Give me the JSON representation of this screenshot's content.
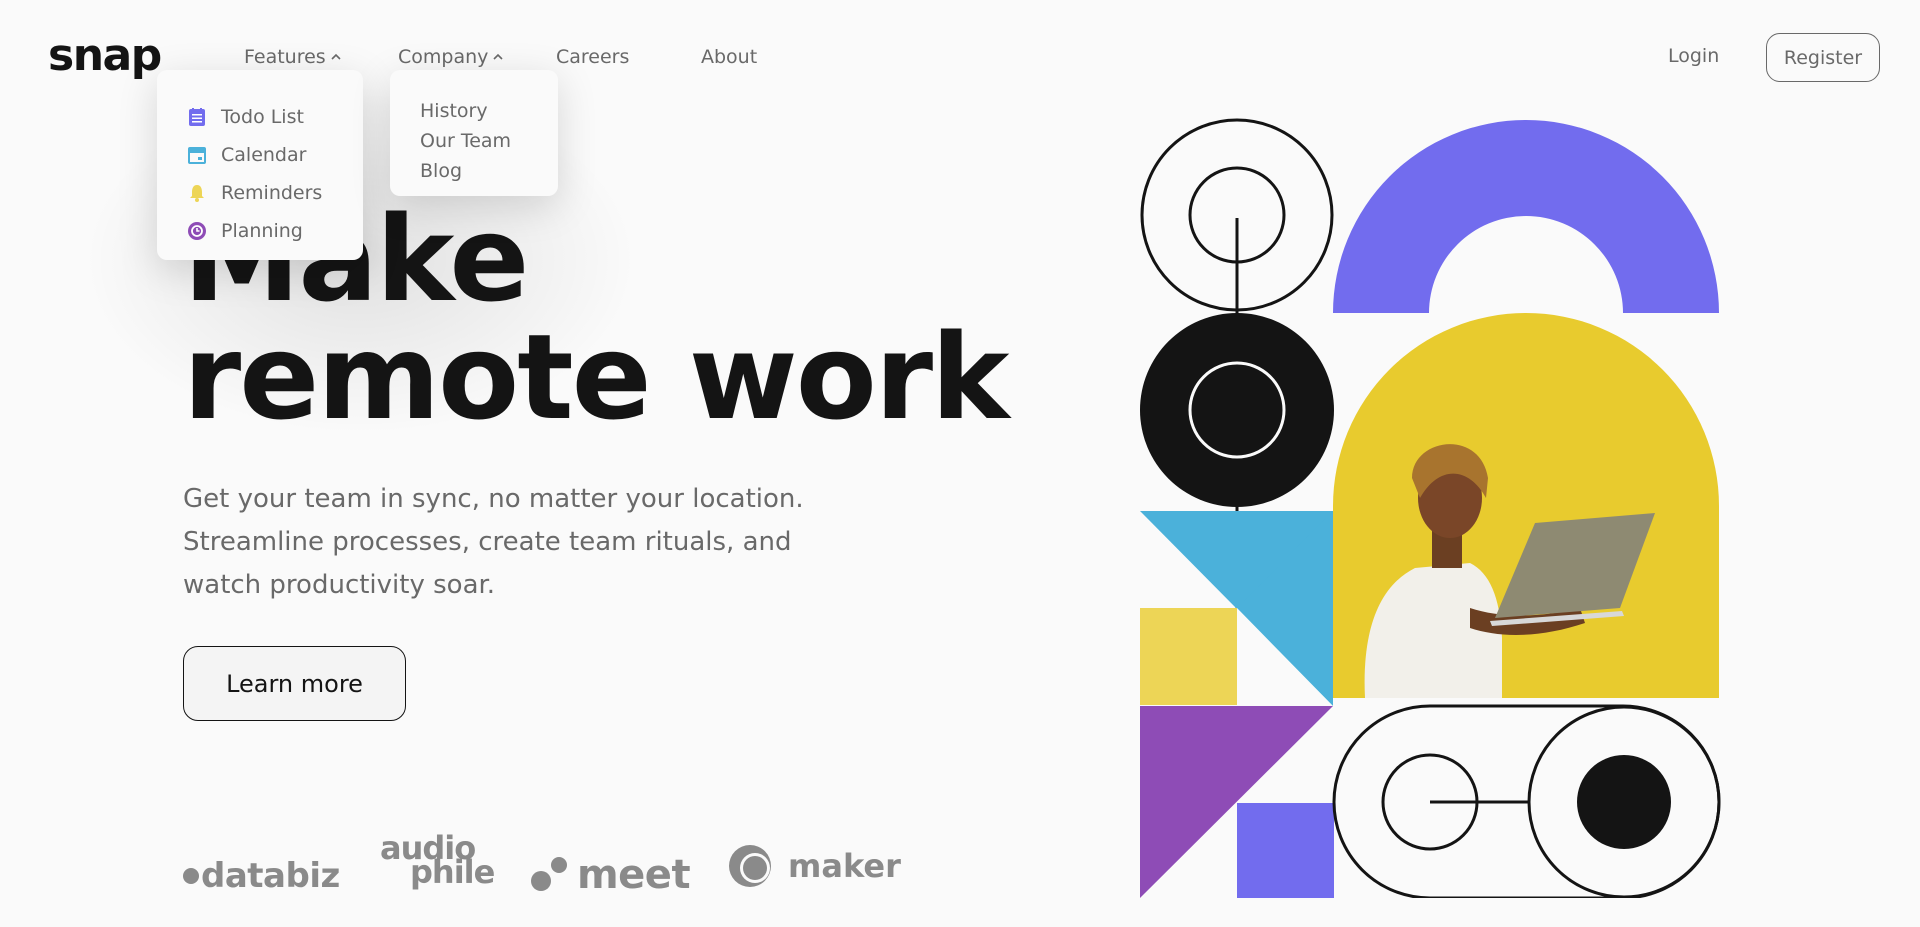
{
  "brand": {
    "logo": "snap"
  },
  "nav": {
    "features": "Features",
    "company": "Company",
    "careers": "Careers",
    "about": "About"
  },
  "auth": {
    "login": "Login",
    "register": "Register"
  },
  "features_menu": [
    {
      "label": "Todo List",
      "icon": "todo-list-icon",
      "color": "#726CEE"
    },
    {
      "label": "Calendar",
      "icon": "calendar-icon",
      "color": "#4BB1DA"
    },
    {
      "label": "Reminders",
      "icon": "bell-icon",
      "color": "#EDD556"
    },
    {
      "label": "Planning",
      "icon": "planning-icon",
      "color": "#8E4CB6"
    }
  ],
  "company_menu": [
    "History",
    "Our Team",
    "Blog"
  ],
  "hero": {
    "title_line1": "Make",
    "title_line2": "remote work",
    "lede_line1": "Get your team in sync, no matter your location.",
    "lede_line2": "Streamline processes, create team rituals, and",
    "lede_line3": "watch productivity soar.",
    "cta": "Learn more"
  },
  "clients": {
    "databiz": "databiz",
    "audiophile_top": "audio",
    "audiophile_bottom": "phile",
    "meet": "meet",
    "maker": "maker"
  },
  "colors": {
    "dark": "#141414",
    "gray": "#696969",
    "purple": "#726CEE",
    "yellow": "#EDD556",
    "blue": "#4BB1DA",
    "violet": "#8E4CB6"
  }
}
